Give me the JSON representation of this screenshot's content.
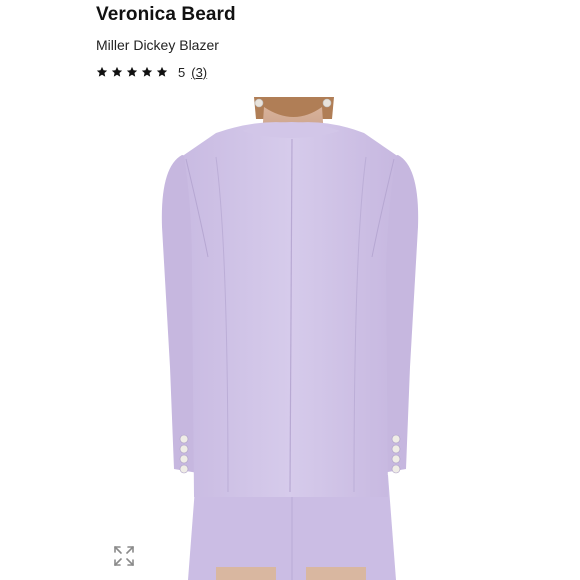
{
  "product": {
    "brand": "Veronica Beard",
    "name": "Miller Dickey Blazer",
    "rating": {
      "stars_filled": 5,
      "stars_total": 5,
      "score": "5",
      "count": "(3)"
    },
    "image": {
      "alt": "Lavender blazer back view",
      "accent_color": "#cfc1e6"
    }
  },
  "icons": {
    "star": "star-icon",
    "expand": "expand-arrows-icon"
  }
}
